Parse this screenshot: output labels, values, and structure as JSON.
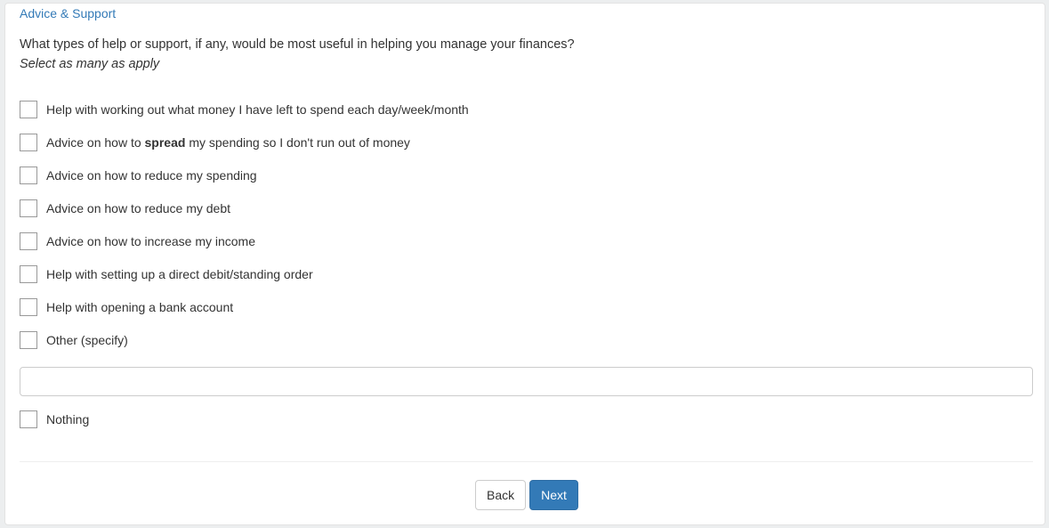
{
  "section_title": "Advice & Support",
  "question": "What types of help or support, if any, would be most useful in helping you manage your finances?",
  "instruction": "Select as many as apply",
  "options": [
    {
      "pre": "Help with working out what money I have left to spend each day/week/month",
      "bold": "",
      "post": "",
      "checked": false
    },
    {
      "pre": "Advice on how to ",
      "bold": "spread",
      "post": " my spending so I don't run out of money",
      "checked": false
    },
    {
      "pre": "Advice on how to reduce my spending",
      "bold": "",
      "post": "",
      "checked": false
    },
    {
      "pre": "Advice on how to reduce my debt",
      "bold": "",
      "post": "",
      "checked": false
    },
    {
      "pre": "Advice on how to increase my income",
      "bold": "",
      "post": "",
      "checked": false
    },
    {
      "pre": "Help with setting up a direct debit/standing order",
      "bold": "",
      "post": "",
      "checked": false
    },
    {
      "pre": "Help with opening a bank account",
      "bold": "",
      "post": "",
      "checked": false
    },
    {
      "pre": "Other (specify)",
      "bold": "",
      "post": "",
      "checked": false
    }
  ],
  "other_input": {
    "value": "",
    "placeholder": ""
  },
  "nothing_option": {
    "label": "Nothing",
    "checked": false
  },
  "buttons": {
    "back": "Back",
    "next": "Next"
  },
  "colors": {
    "accent": "#337ab7",
    "text": "#333333"
  }
}
